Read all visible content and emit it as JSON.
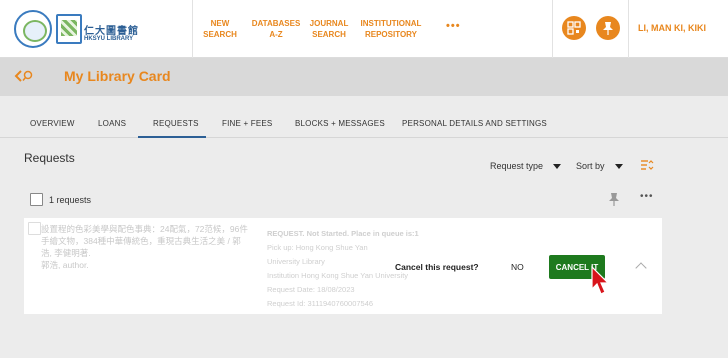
{
  "header": {
    "logo_cn": "仁大圖書館",
    "logo_en": "HKSYU LIBRARY",
    "logo_ring": "樹仁大學",
    "nav": [
      {
        "line1": "NEW",
        "line2": "SEARCH"
      },
      {
        "line1": "DATABASES",
        "line2": "A-Z"
      },
      {
        "line1": "JOURNAL",
        "line2": "SEARCH"
      },
      {
        "line1": "INSTITUTIONAL",
        "line2": "REPOSITORY"
      }
    ],
    "more": "•••",
    "user_name": "LI, MAN KI, KIKI"
  },
  "title": "My Library Card",
  "tabs": [
    "OVERVIEW",
    "LOANS",
    "REQUESTS",
    "FINE + FEES",
    "BLOCKS + MESSAGES",
    "PERSONAL DETAILS AND SETTINGS"
  ],
  "active_tab": "REQUESTS",
  "requests": {
    "heading": "Requests",
    "sort1": "Request type",
    "sort2": "Sort by",
    "count_label": "1 requests",
    "more": "•••"
  },
  "item": {
    "title": "設置程的色彩美學與配色事典：24配氣，72范候，96件手繪文物，384種中華傳統色，重現古典生活之美 / 郭浩, 李健明著.",
    "author": "郭浩, author.",
    "status": "REQUEST. Not Started. Place in queue is:1",
    "pickup": "Pick up: Hong Kong Shue Yan",
    "pickup2": "University Library",
    "institution": "Institution Hong Kong Shue Yan University",
    "date": "Request Date: 18/08/2023",
    "id": "Request Id: 3111940760007546"
  },
  "confirm": {
    "question": "Cancel this request?",
    "no": "NO",
    "yes": "CANCEL IT"
  },
  "colors": {
    "accent": "#e8871e",
    "primary": "#2c5f95",
    "confirm": "#1e7a1e"
  }
}
